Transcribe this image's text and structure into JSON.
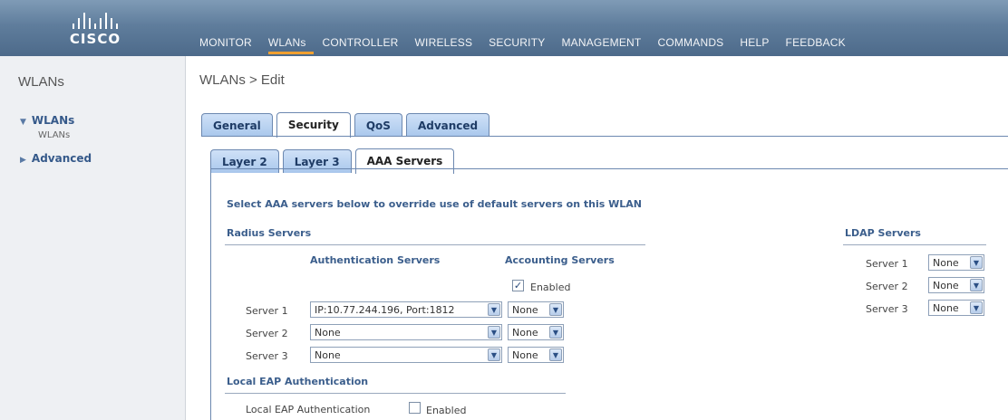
{
  "logo": {
    "text": "cisco"
  },
  "menu": [
    {
      "label": "MONITOR"
    },
    {
      "label": "WLANs"
    },
    {
      "label": "CONTROLLER"
    },
    {
      "label": "WIRELESS"
    },
    {
      "label": "SECURITY"
    },
    {
      "label": "MANAGEMENT"
    },
    {
      "label": "COMMANDS"
    },
    {
      "label": "HELP"
    },
    {
      "label": "FEEDBACK"
    }
  ],
  "sidebar": {
    "title": "WLANs",
    "wlans_link": "WLANs",
    "wlans_sub": "WLANs",
    "advanced_link": "Advanced"
  },
  "page": {
    "title": "WLANs > Edit"
  },
  "tabs_main": [
    "General",
    "Security",
    "QoS",
    "Advanced"
  ],
  "tabs_sub": [
    "Layer 2",
    "Layer 3",
    "AAA Servers"
  ],
  "content": {
    "hint": "Select AAA servers below to override use of default servers on this WLAN",
    "radius_title": "Radius Servers",
    "auth_header": "Authentication Servers",
    "acct_header": "Accounting Servers",
    "acct_enabled_label": "Enabled",
    "server1_label": "Server 1",
    "server2_label": "Server 2",
    "server3_label": "Server 3",
    "auth1": "IP:10.77.244.196, Port:1812",
    "auth2": "None",
    "auth3": "None",
    "acct1": "None",
    "acct2": "None",
    "acct3": "None",
    "local_eap_title": "Local EAP Authentication",
    "local_eap_label": "Local EAP Authentication",
    "local_eap_enabled_label": "Enabled",
    "ldap_title": "LDAP Servers",
    "ldap1": "None",
    "ldap2": "None",
    "ldap3": "None"
  }
}
